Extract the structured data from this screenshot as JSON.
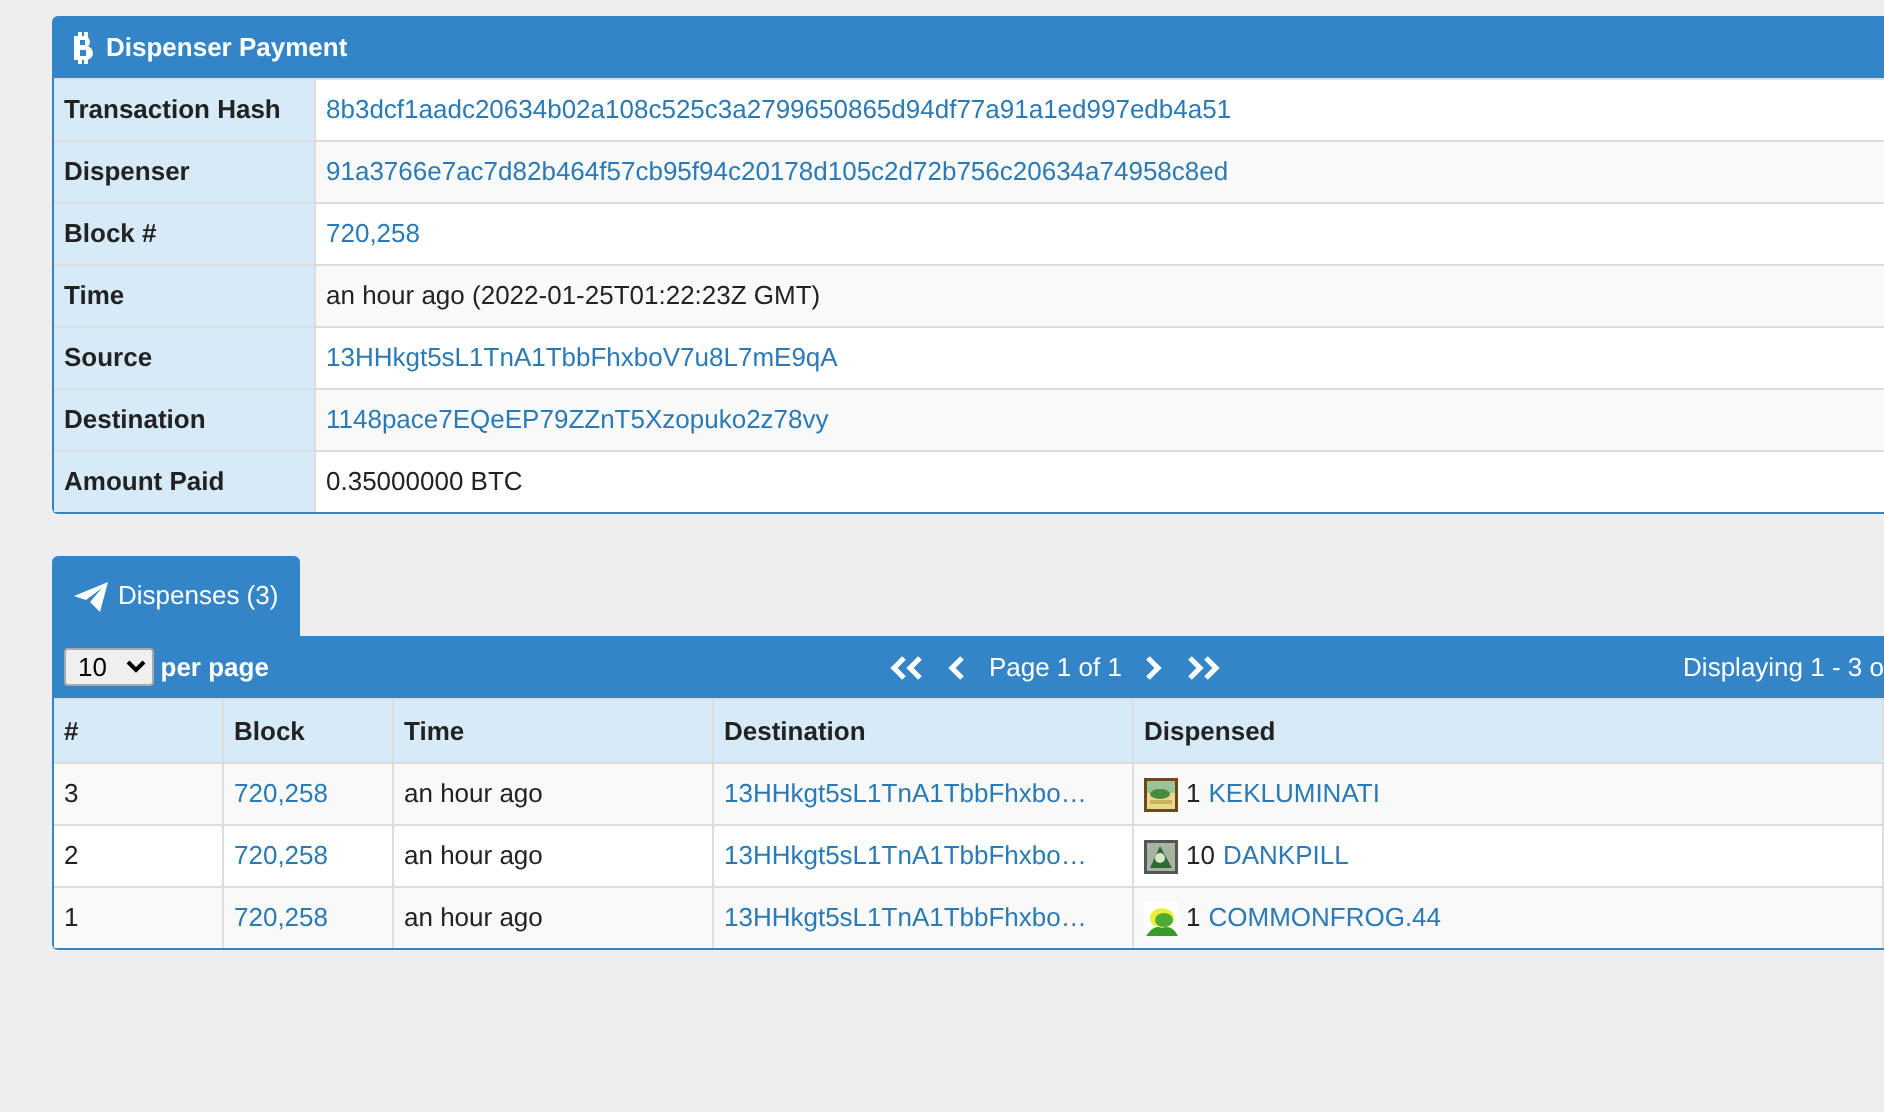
{
  "panel": {
    "title": "Dispenser Payment",
    "fields": [
      {
        "label": "Transaction Hash",
        "value": "8b3dcf1aadc20634b02a108c525c3a2799650865d94df77a91a1ed997edb4a51",
        "kind": "link"
      },
      {
        "label": "Dispenser",
        "value": "91a3766e7ac7d82b464f57cb95f94c20178d105c2d72b756c20634a74958c8ed",
        "kind": "link"
      },
      {
        "label": "Block #",
        "value": "720,258",
        "kind": "link"
      },
      {
        "label": "Time",
        "value": "an hour ago (2022-01-25T01:22:23Z GMT)",
        "kind": "text"
      },
      {
        "label": "Source",
        "value": "13HHkgt5sL1TnA1TbbFhxboV7u8L7mE9qA",
        "kind": "link"
      },
      {
        "label": "Destination",
        "value": "1148pace7EQeEP79ZZnT5Xzopuko2z78vy",
        "kind": "link"
      },
      {
        "label": "Amount Paid",
        "value": "0.35000000 BTC",
        "kind": "text"
      }
    ]
  },
  "tabs": [
    {
      "label": "Dispenses (3)",
      "selected": true
    }
  ],
  "toolbar": {
    "per_page": "10",
    "per_page_label": "per page",
    "page_info": "Page 1 of 1",
    "displaying": "Displaying 1 - 3 o"
  },
  "table": {
    "columns": [
      "#",
      "Block",
      "Time",
      "Destination",
      "Dispensed"
    ],
    "rows": [
      {
        "number": "3",
        "block": "720,258",
        "time": "an hour ago",
        "destination": "13HHkgt5sL1TnA1TbbFhxbo…",
        "quantity": "1",
        "asset": "KEKLUMINATI"
      },
      {
        "number": "2",
        "block": "720,258",
        "time": "an hour ago",
        "destination": "13HHkgt5sL1TnA1TbbFhxbo…",
        "quantity": "10",
        "asset": "DANKPILL"
      },
      {
        "number": "1",
        "block": "720,258",
        "time": "an hour ago",
        "destination": "13HHkgt5sL1TnA1TbbFhxbo…",
        "quantity": "1",
        "asset": "COMMONFROG.44"
      }
    ]
  }
}
